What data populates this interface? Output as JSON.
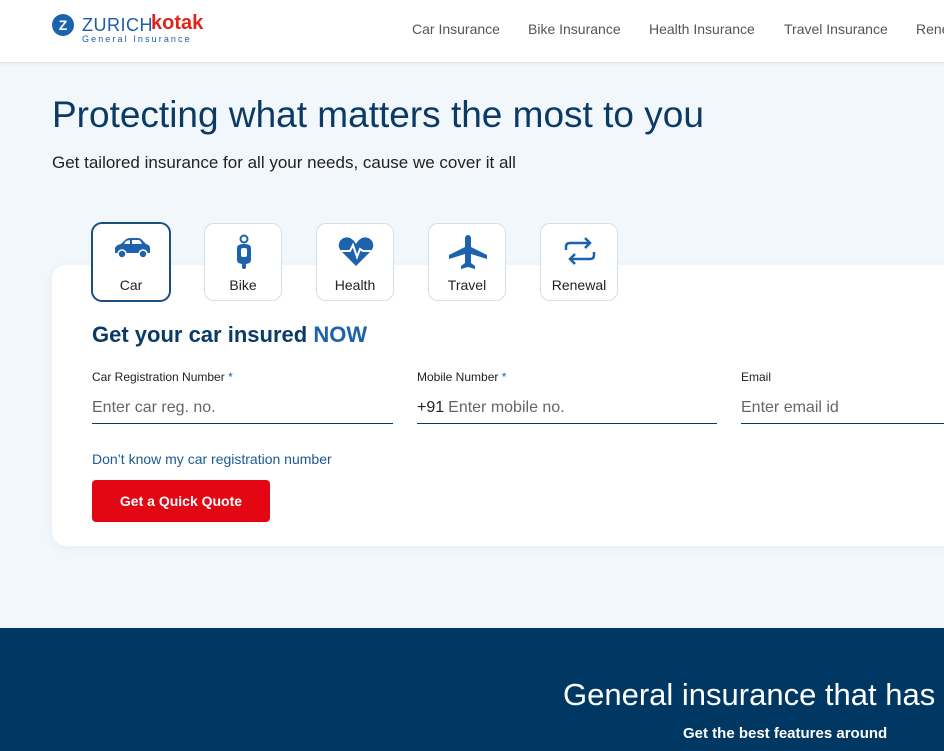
{
  "brand": {
    "name_part1": "ZURICH",
    "name_part2": "kotak",
    "tagline": "General Insurance",
    "logo_mark": "Z"
  },
  "nav": {
    "items": [
      {
        "label": "Car Insurance"
      },
      {
        "label": "Bike Insurance"
      },
      {
        "label": "Health Insurance"
      },
      {
        "label": "Travel Insurance"
      },
      {
        "label": "Rene"
      }
    ]
  },
  "hero": {
    "title": "Protecting what matters the most to you",
    "subtitle": "Get tailored insurance for all your needs, cause we cover it all"
  },
  "product_tabs": [
    {
      "label": "Car",
      "icon": "car-icon",
      "active": true
    },
    {
      "label": "Bike",
      "icon": "scooter-icon",
      "active": false
    },
    {
      "label": "Health",
      "icon": "heart-pulse-icon",
      "active": false
    },
    {
      "label": "Travel",
      "icon": "airplane-icon",
      "active": false
    },
    {
      "label": "Renewal",
      "icon": "renew-arrows-icon",
      "active": false
    }
  ],
  "form": {
    "title_prefix": "Get your car insured",
    "title_highlight": "NOW",
    "fields": [
      {
        "label": "Car Registration Number",
        "required_mark": "*",
        "placeholder": "Enter car reg. no.",
        "prefix": ""
      },
      {
        "label": "Mobile Number",
        "required_mark": "*",
        "placeholder": "Enter mobile no.",
        "prefix": "+91"
      },
      {
        "label": "Email",
        "required_mark": "",
        "placeholder": "Enter email id",
        "prefix": ""
      }
    ],
    "help_link": "Don’t know my car registration number",
    "submit_label": "Get a Quick Quote"
  },
  "band": {
    "title": "General insurance that has",
    "subtitle": "Get the best features around"
  },
  "colors": {
    "primary_navy": "#0b3a66",
    "accent_blue": "#1d62ac",
    "brand_red": "#e30613",
    "band_bg": "#003863",
    "page_bg": "#f2f7fb"
  }
}
